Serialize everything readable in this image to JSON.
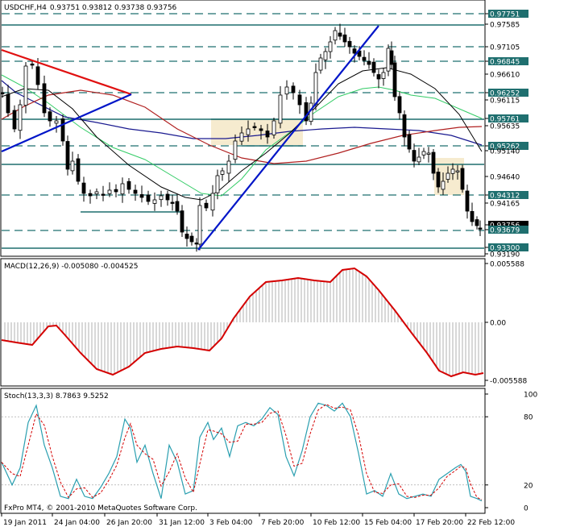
{
  "header": {
    "symbol": "USDCHF,H4",
    "quote": "0.93751 0.93812 0.93738 0.93756"
  },
  "macd": {
    "label": "MACD(12,26,9) -0.005080 -0.004525"
  },
  "stoch": {
    "label": "Stoch(13,3,3) 8.7863 9.5252"
  },
  "footer": {
    "credit": "FxPro MT4, © 2001-2010 MetaQuotes Software Corp."
  },
  "price_axis": [
    {
      "label": "0.97751",
      "boxed": true
    },
    {
      "label": "0.97585",
      "boxed": false
    },
    {
      "label": "0.97105",
      "boxed": false
    },
    {
      "label": "0.96845",
      "boxed": true
    },
    {
      "label": "0.96610",
      "boxed": false
    },
    {
      "label": "0.96252",
      "boxed": true
    },
    {
      "label": "0.96115",
      "boxed": false
    },
    {
      "label": "0.95761",
      "boxed": true
    },
    {
      "label": "0.95635",
      "boxed": false
    },
    {
      "label": "0.95262",
      "boxed": true
    },
    {
      "label": "0.95140",
      "boxed": false
    },
    {
      "label": "0.94640",
      "boxed": false
    },
    {
      "label": "0.94312",
      "boxed": true
    },
    {
      "label": "0.94165",
      "boxed": false
    },
    {
      "label": "0.93756",
      "boxed": true,
      "dark": true
    },
    {
      "label": "0.93679",
      "boxed": true
    },
    {
      "label": "0.93300",
      "boxed": true
    },
    {
      "label": "0.93190",
      "boxed": false
    }
  ],
  "macd_axis": [
    "0.005588",
    "0.00",
    "-0.005588"
  ],
  "stoch_axis": [
    "100",
    "80",
    "20",
    "0"
  ],
  "time_axis": [
    "19 Jan 2011",
    "24 Jan 04:00",
    "26 Jan 20:00",
    "31 Jan 12:00",
    "3 Feb 04:00",
    "7 Feb 20:00",
    "10 Feb 12:00",
    "15 Feb 04:00",
    "17 Feb 20:00",
    "22 Feb 12:00"
  ],
  "colors": {
    "hline": "#1f6f6f",
    "price": "#000000",
    "macd_signal": "#d40000",
    "macd_hist": "#b0b0b0",
    "stoch_main": "#2a9fb0",
    "stoch_signal": "#d40000",
    "trend_blue": "#0015c8",
    "trend_red": "#e01010",
    "ma_green": "#33cc66",
    "ma_blue": "#1a1a90",
    "ma_red": "#b02020",
    "ma_black": "#000000",
    "zone": "#f6ebcf"
  }
}
